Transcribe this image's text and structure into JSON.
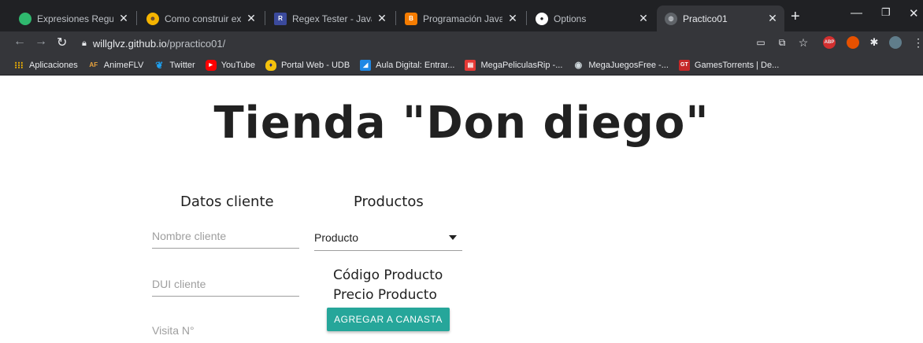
{
  "browser": {
    "tabs": [
      {
        "title": "Expresiones Regulares en",
        "icon": "regex-icon",
        "color": "#2fb86e",
        "active": false
      },
      {
        "title": "Como construir expresio",
        "icon": "emoji-icon",
        "color": "#f5b400",
        "active": false
      },
      {
        "title": "Regex Tester - Javascrip",
        "icon": "regex-tester-icon",
        "color": "#3b4a9c",
        "active": false
      },
      {
        "title": "Programación Java: Ejer",
        "icon": "blogger-icon",
        "color": "#f57c00",
        "active": false
      },
      {
        "title": "Options",
        "icon": "github-icon",
        "color": "#ffffff",
        "active": false
      },
      {
        "title": "Practico01",
        "icon": "globe-icon",
        "color": "#9aa0a6",
        "active": true
      }
    ],
    "url_host": "willglvz.github.io",
    "url_path": "/ppractico01/",
    "bookmarks": [
      {
        "label": "Aplicaciones",
        "icon": "apps-grid-icon",
        "color": "#f4b400"
      },
      {
        "label": "AnimeFLV",
        "icon": "animeflv-icon",
        "color": "#e8a33d"
      },
      {
        "label": "Twitter",
        "icon": "twitter-icon",
        "color": "#1da1f2"
      },
      {
        "label": "YouTube",
        "icon": "youtube-icon",
        "color": "#ff0000"
      },
      {
        "label": "Portal Web - UDB",
        "icon": "udb-icon",
        "color": "#f4c20d"
      },
      {
        "label": "Aula Digital: Entrar...",
        "icon": "aula-digital-icon",
        "color": "#1e88e5"
      },
      {
        "label": "MegaPeliculasRip -...",
        "icon": "clapper-icon",
        "color": "#e53935"
      },
      {
        "label": "MegaJuegosFree -...",
        "icon": "gamepad-icon",
        "color": "#9aa0a6"
      },
      {
        "label": "GamesTorrents | De...",
        "icon": "gamestorrents-icon",
        "color": "#c62828"
      }
    ]
  },
  "page": {
    "title": "Tienda \"Don diego\"",
    "cliente": {
      "heading": "Datos cliente",
      "nombre_placeholder": "Nombre cliente",
      "dui_placeholder": "DUI cliente",
      "visita_placeholder": "Visita N°"
    },
    "productos": {
      "heading": "Productos",
      "select_value": "Producto",
      "codigo_label": "Código Producto",
      "precio_label": "Precio Producto",
      "add_button": "AGREGAR A CANASTA"
    },
    "accent_color": "#26a69a"
  }
}
